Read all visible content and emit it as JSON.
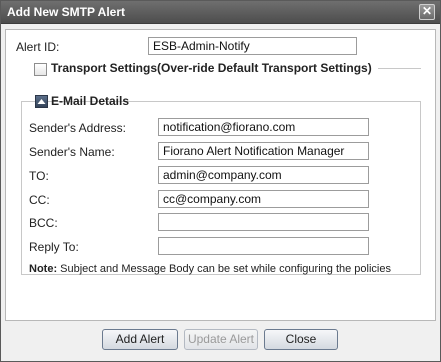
{
  "window": {
    "title": "Add New SMTP Alert",
    "close_glyph": "✕"
  },
  "form": {
    "alert_id_label": "Alert ID:",
    "alert_id_value": "ESB-Admin-Notify",
    "transport_label": "Transport Settings(Over-ride Default Transport Settings)",
    "transport_checked": false,
    "email_section_label": "E-Mail Details",
    "fields": [
      {
        "label": "Sender's Address:",
        "value": "notification@fiorano.com"
      },
      {
        "label": "Sender's Name:",
        "value": "Fiorano Alert Notification Manager"
      },
      {
        "label": "TO:",
        "value": "admin@company.com"
      },
      {
        "label": "CC:",
        "value": "cc@company.com"
      },
      {
        "label": "BCC:",
        "value": ""
      },
      {
        "label": "Reply To:",
        "value": ""
      }
    ],
    "note_prefix": "Note:",
    "note_text": " Subject and Message Body can be set while configuring the policies"
  },
  "buttons": {
    "add_label": "Add Alert",
    "update_label": "Update Alert",
    "close_label": "Close"
  },
  "icons": {
    "close": "close-icon",
    "collapse": "collapse-icon"
  },
  "colors": {
    "titlebar": "#5a5a5a",
    "button_border": "#6b7a8f"
  }
}
